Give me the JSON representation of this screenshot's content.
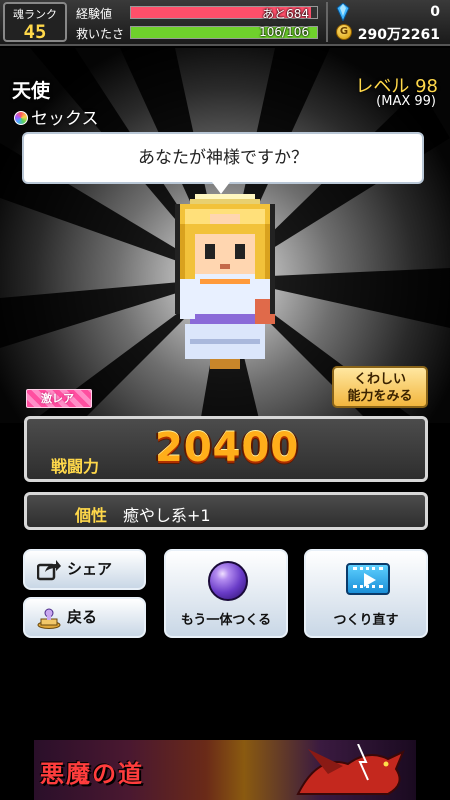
{
  "header": {
    "rank_label": "魂ランク",
    "rank_value": "45",
    "exp_label": "経験値",
    "exp_text": "あと684",
    "exp_fill_fraction": 0.97,
    "rescue_label": "救いたさ",
    "rescue_text": "106/106",
    "rescue_fill_fraction": 1.0,
    "gem_icon": "blue-gem-icon",
    "gem_value": "0",
    "coin_icon": "gold-coin-icon",
    "coin_symbol": "G",
    "coin_value": "290万2261",
    "colors": {
      "exp_bar": "#ff4f6a",
      "rescue_bar": "#6fd12c",
      "rank_value": "#ffd84a"
    }
  },
  "character": {
    "name": "天使",
    "sex": "セックス",
    "level": "レベル 98",
    "max_level": "(MAX 99)",
    "speech": "あなたが神様ですか？",
    "rarity": "激レア",
    "detail_button": [
      "くわしい",
      "能力をみる"
    ]
  },
  "stats": {
    "power_label": "戦闘力",
    "power_value": "20400",
    "trait_label": "個性",
    "trait_value": "癒やし系+1"
  },
  "buttons": {
    "share": "シェア",
    "back": "戻る",
    "one_more": "もう一体つくる",
    "remake": "つくり直す"
  },
  "ad": {
    "title": "悪魔の道"
  }
}
